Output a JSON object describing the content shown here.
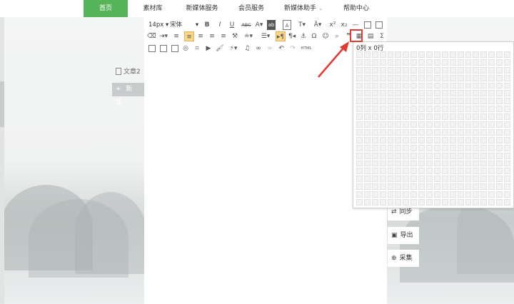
{
  "nav": {
    "items": [
      {
        "label": "首页",
        "active": true
      },
      {
        "label": "素材库"
      },
      {
        "label": "新媒体服务"
      },
      {
        "label": "会员服务"
      },
      {
        "label": "新媒体助手"
      },
      {
        "label": "帮助中心"
      }
    ]
  },
  "doc": {
    "label": "文章2",
    "new_button": "+ 新 建"
  },
  "toolbar": {
    "font_size": "14px",
    "font_family": "宋体",
    "row1_icons": [
      "bold-icon",
      "italic-icon",
      "underline-icon",
      "strikethrough-icon",
      "font-color-icon",
      "font-background-icon",
      "clear-format-icon",
      "superscript-icon",
      "subscript-icon",
      "horizontal-rule-icon",
      "blank-page-icon",
      "fullscreen-icon"
    ],
    "row2_icons": [
      "eraser-icon",
      "indent-icon",
      "line-spacing-icon",
      "align-left-icon",
      "align-center-icon",
      "align-right-icon",
      "justify-icon",
      "format-painter-icon",
      "paragraph-spacing-icon",
      "list-icon",
      "ltr-icon",
      "rtl-icon",
      "anchor-icon",
      "special-char-icon",
      "emoji-icon",
      "search-replace-icon",
      "quote-icon",
      "table-icon",
      "template-icon",
      "formula-icon"
    ],
    "row3_icons": [
      "image-icon",
      "image-gallery-icon",
      "frame-icon",
      "circle-image-icon",
      "screenshot-icon",
      "video-icon",
      "brush-icon",
      "magic-wand-icon",
      "music-icon",
      "link-icon",
      "unlink-icon",
      "undo-icon",
      "redo-icon",
      "html-icon"
    ],
    "html_label": "HTML"
  },
  "table_picker": {
    "label": "0列 x 0行",
    "rows": 20,
    "cols": 20
  },
  "side_buttons": [
    {
      "label": "同步",
      "icon": "sync-icon"
    },
    {
      "label": "导出",
      "icon": "export-icon"
    },
    {
      "label": "采集",
      "icon": "collect-icon"
    }
  ],
  "colors": {
    "accent": "#55b45a",
    "highlight": "#e13a32"
  }
}
